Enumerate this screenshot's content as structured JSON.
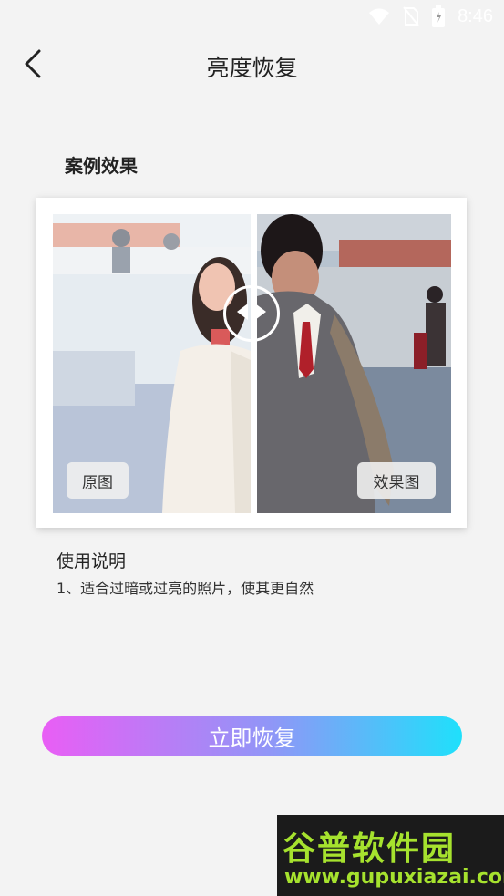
{
  "status_bar": {
    "time": "8:46"
  },
  "header": {
    "title": "亮度恢复"
  },
  "example": {
    "section_title": "案例效果",
    "label_original": "原图",
    "label_effect": "效果图"
  },
  "usage": {
    "title": "使用说明",
    "line1": "1、适合过暗或过亮的照片，使其更自然"
  },
  "action": {
    "restore_label": "立即恢复"
  },
  "watermark": {
    "name": "谷普软件园",
    "url": "www.gupuxiazai.com"
  },
  "colors": {
    "gradient_start": "#e95ef5",
    "gradient_end": "#1fe0fb",
    "background": "#f3f3f3"
  }
}
